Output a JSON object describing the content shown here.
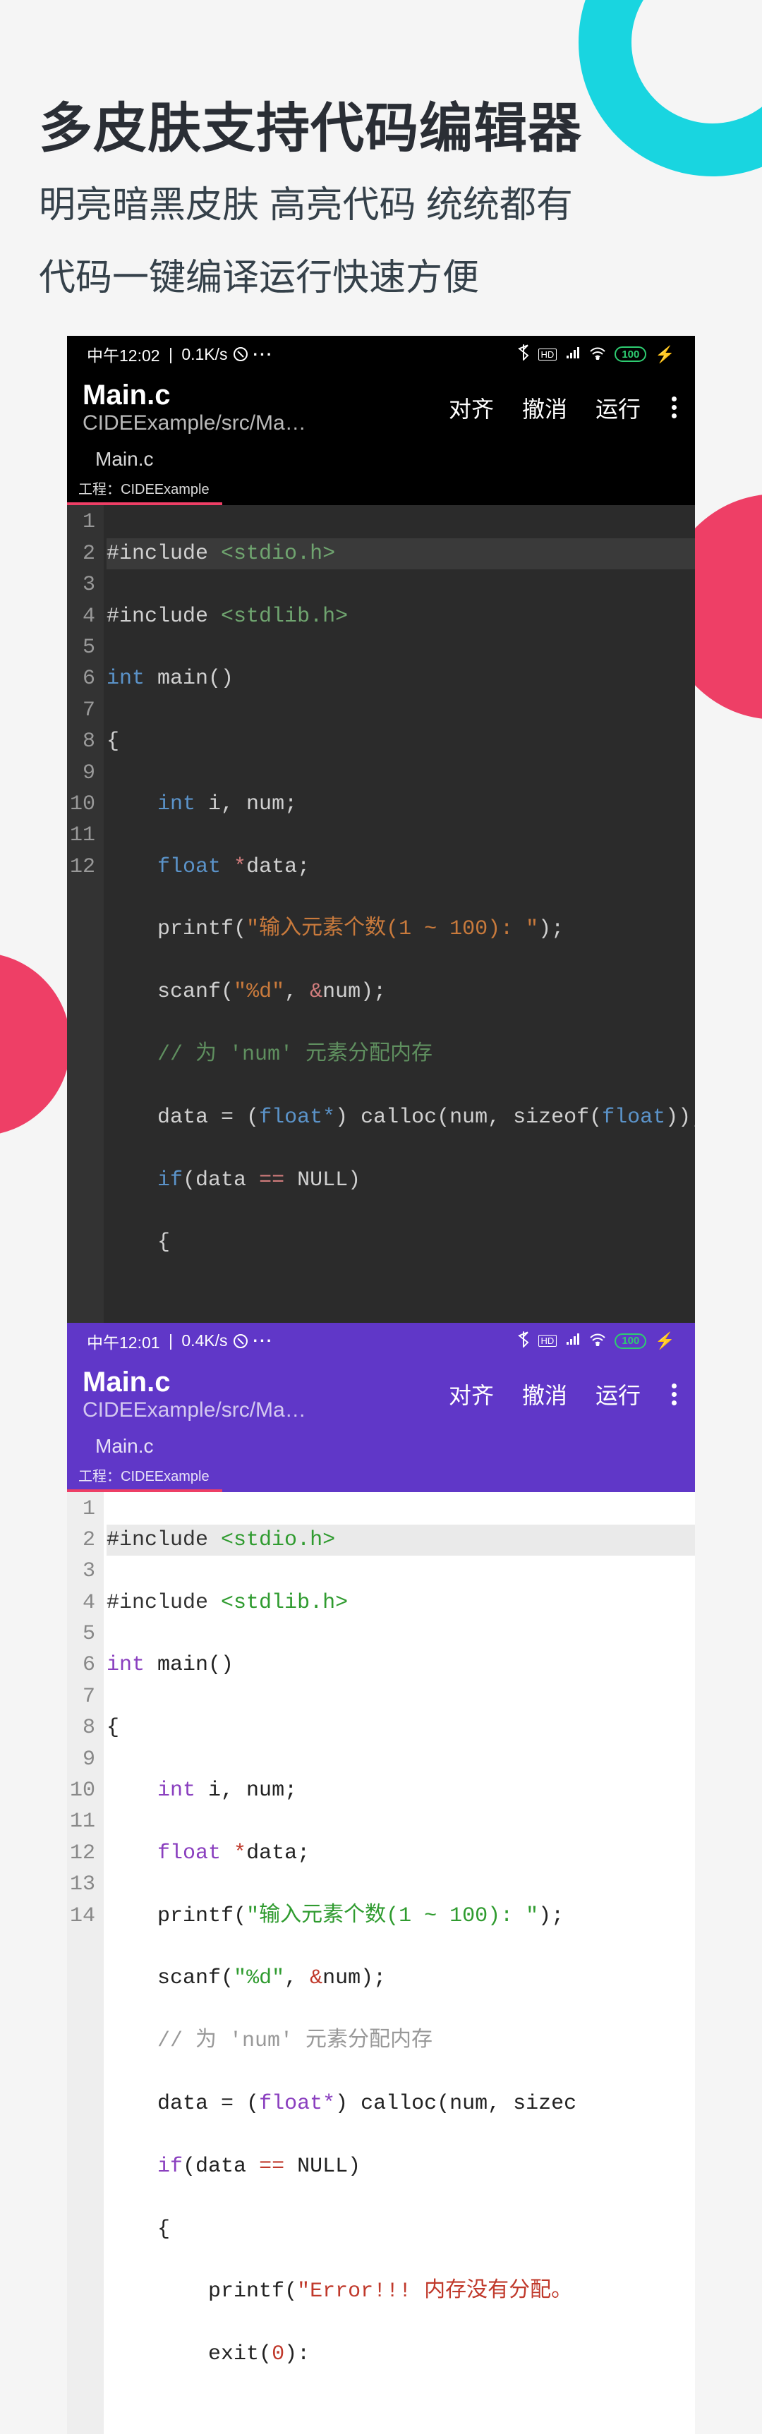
{
  "heading": {
    "title": "多皮肤支持代码编辑器",
    "sub1": "明亮暗黑皮肤 高亮代码 统统都有",
    "sub2": "代码一键编译运行快速方便"
  },
  "dark": {
    "status": {
      "time": "中午12:02",
      "speed": "0.1K/s",
      "dots": "···",
      "hd": "HD",
      "battery": "100"
    },
    "app": {
      "title": "Main.c",
      "sub": "CIDEExample/src/Mai…",
      "a1": "对齐",
      "a2": "撤消",
      "a3": "运行"
    },
    "tab": "Main.c",
    "proj_label": "工程：",
    "proj_name": "CIDEExample",
    "lines": [
      "1",
      "2",
      "3",
      "4",
      "5",
      "6",
      "7",
      "8",
      "9",
      "10",
      "11",
      "12"
    ]
  },
  "light": {
    "status": {
      "time": "中午12:01",
      "speed": "0.4K/s",
      "dots": "···",
      "hd": "HD",
      "battery": "100"
    },
    "app": {
      "title": "Main.c",
      "sub": "CIDEExample/src/Mai…",
      "a1": "对齐",
      "a2": "撤消",
      "a3": "运行"
    },
    "tab": "Main.c",
    "proj_label": "工程：",
    "proj_name": "CIDEExample",
    "lines": [
      "1",
      "2",
      "3",
      "4",
      "5",
      "6",
      "7",
      "8",
      "9",
      "10",
      "11",
      "12",
      "13",
      "14"
    ]
  },
  "code": {
    "inc1a": "#include ",
    "inc1b": "<stdio.h>",
    "inc2a": "#include ",
    "inc2b": "<stdlib.h>",
    "kw_int": "int",
    "kw_float": "float",
    "main_decl": " main()",
    "brace_o": "{",
    "brace_c": "}",
    "decl_i": " i, num;",
    "star": " *",
    "data_decl": "data;",
    "printf": "printf",
    "scanf": "scanf",
    "lp": "(",
    "rp": ")",
    "semi": ";",
    "str_prompt": "\"输入元素个数(1 ~ 100): \"",
    "str_fmt": "\"%d\"",
    "comma_sp": ", ",
    "amp": "&",
    "num_id": "num",
    "comment": "// 为 'num' 元素分配内存",
    "data_eq": "data = (",
    "float_cast": "float*",
    "rp_sp": ") ",
    "calloc": "calloc(num, sizeof(",
    "calloc_end": "));",
    "calloc_short": "calloc(num, sizec",
    "if": "if",
    "if_cond_a": "(data ",
    "eqeq": "==",
    "if_cond_b": " NULL)",
    "brace_o2": "{",
    "err_str": "\"Error!!! 内存没有分配。",
    "exit_call": "exit(",
    "zero": "0",
    "exit_end": "):"
  }
}
